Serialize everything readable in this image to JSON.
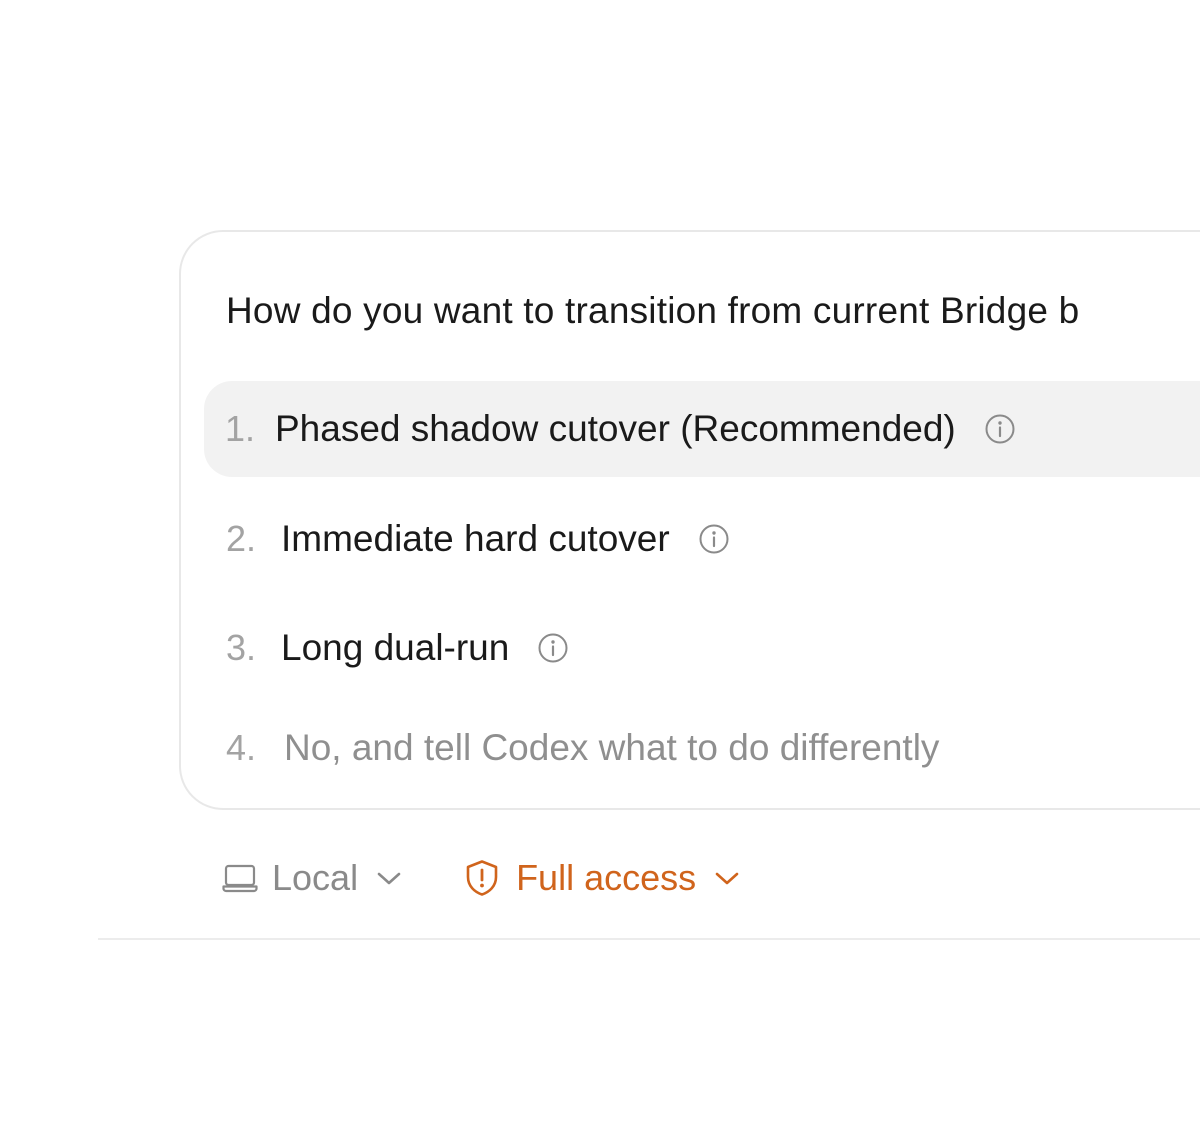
{
  "question": "How do you want to transition from current Bridge b",
  "options": [
    {
      "number": "1.",
      "label": "Phased shadow cutover (Recommended)",
      "icon": "info-icon",
      "selected": true
    },
    {
      "number": "2.",
      "label": "Immediate hard cutover",
      "icon": "info-icon",
      "selected": false
    },
    {
      "number": "3.",
      "label": "Long dual-run",
      "icon": "info-icon",
      "selected": false
    },
    {
      "number": "4.",
      "label": "No, and tell Codex what to do differently",
      "selected": false
    }
  ],
  "footer": {
    "environment": {
      "label": "Local",
      "icon": "laptop-icon"
    },
    "access": {
      "label": "Full access",
      "icon": "shield-alert-icon",
      "color": "#d0641c"
    }
  },
  "colors": {
    "text": "#1a1a1a",
    "muted": "#8f8f8f",
    "number": "#a3a3a3",
    "selected_bg": "#f2f2f2",
    "border": "#e8e8e8",
    "accent": "#d0641c"
  }
}
